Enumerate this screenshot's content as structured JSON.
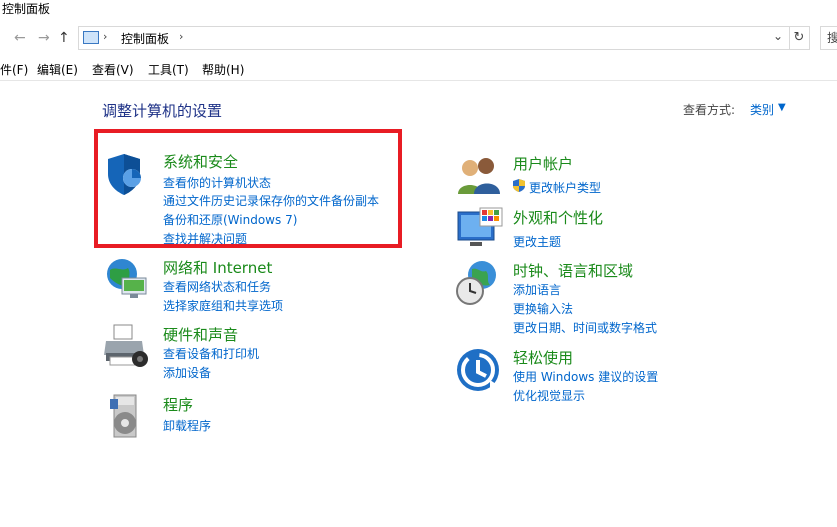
{
  "window": {
    "title": "控制面板"
  },
  "address": {
    "crumb": "控制面板",
    "sep1": "›",
    "sep2": "›"
  },
  "nav": {
    "back": "←",
    "forward": "→",
    "up": "↑",
    "dropdown": "⌄",
    "refresh": "↻",
    "search": "搜"
  },
  "menu": [
    "件(F)",
    "编辑(E)",
    "查看(V)",
    "工具(T)",
    "帮助(H)"
  ],
  "header": {
    "heading": "调整计算机的设置",
    "viewby_label": "查看方式:",
    "viewby_value": "类别",
    "viewby_caret": "▼"
  },
  "categories": {
    "system_security": {
      "title": "系统和安全",
      "links": [
        "查看你的计算机状态",
        "通过文件历史记录保存你的文件备份副本",
        "备份和还原(Windows 7)",
        "查找并解决问题"
      ]
    },
    "network": {
      "title": "网络和 Internet",
      "links": [
        "查看网络状态和任务",
        "选择家庭组和共享选项"
      ]
    },
    "hardware": {
      "title": "硬件和声音",
      "links": [
        "查看设备和打印机",
        "添加设备"
      ]
    },
    "programs": {
      "title": "程序",
      "links": [
        "卸载程序"
      ]
    },
    "user_accounts": {
      "title": "用户帐户",
      "links": [
        "更改帐户类型"
      ]
    },
    "appearance": {
      "title": "外观和个性化",
      "links": [
        "更改主题"
      ]
    },
    "clock_region": {
      "title": "时钟、语言和区域",
      "links": [
        "添加语言",
        "更换输入法",
        "更改日期、时间或数字格式"
      ]
    },
    "ease_access": {
      "title": "轻松使用",
      "links": [
        "使用 Windows 建议的设置",
        "优化视觉显示"
      ]
    }
  },
  "colors": {
    "link": "#0066cc",
    "category_title": "#1a8a1a",
    "heading": "#1e3287",
    "highlight": "#e81c24"
  }
}
